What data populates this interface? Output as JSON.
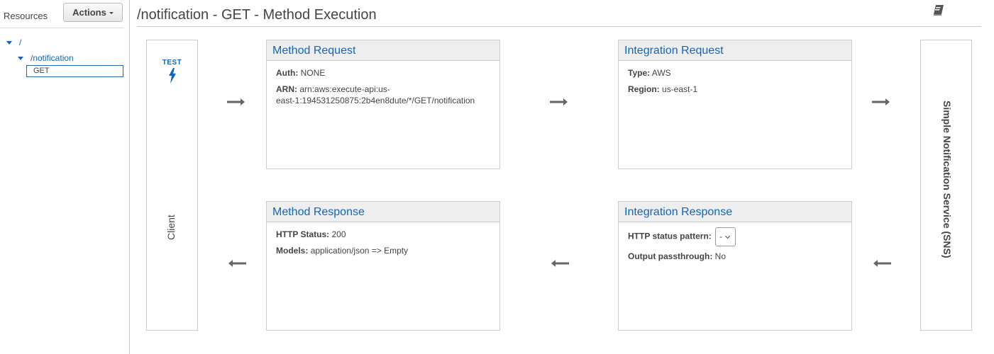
{
  "sidebar": {
    "title": "Resources",
    "actions_label": "Actions",
    "tree": [
      {
        "label": "/",
        "expanded": true
      },
      {
        "label": "/notification",
        "expanded": true
      },
      {
        "label": "GET",
        "selected": true
      }
    ]
  },
  "header": {
    "title": "/notification - GET - Method Execution",
    "docs_icon": "book-icon"
  },
  "client": {
    "test_label": "TEST",
    "test_icon": "lightning-bolt-icon",
    "label": "Client"
  },
  "backend": {
    "label": "Simple Notification Service (SNS)"
  },
  "method_request": {
    "title": "Method Request",
    "auth_label": "Auth:",
    "auth_value": "NONE",
    "arn_label": "ARN:",
    "arn_value": "arn:aws:execute-api:us-east-1:194531250875:2b4en8dute/*/GET/notification"
  },
  "integration_request": {
    "title": "Integration Request",
    "type_label": "Type:",
    "type_value": "AWS",
    "region_label": "Region:",
    "region_value": "us-east-1"
  },
  "method_response": {
    "title": "Method Response",
    "status_label": "HTTP Status:",
    "status_value": "200",
    "models_label": "Models:",
    "models_value": "application/json => Empty"
  },
  "integration_response": {
    "title": "Integration Response",
    "pattern_label": "HTTP status pattern:",
    "pattern_selected": "-",
    "passthrough_label": "Output passthrough:",
    "passthrough_value": "No"
  },
  "colors": {
    "link": "#1166bb",
    "text": "#444444",
    "border": "#cccccc",
    "panel_header_bg": "#eeeeee",
    "arrow": "#666666"
  }
}
